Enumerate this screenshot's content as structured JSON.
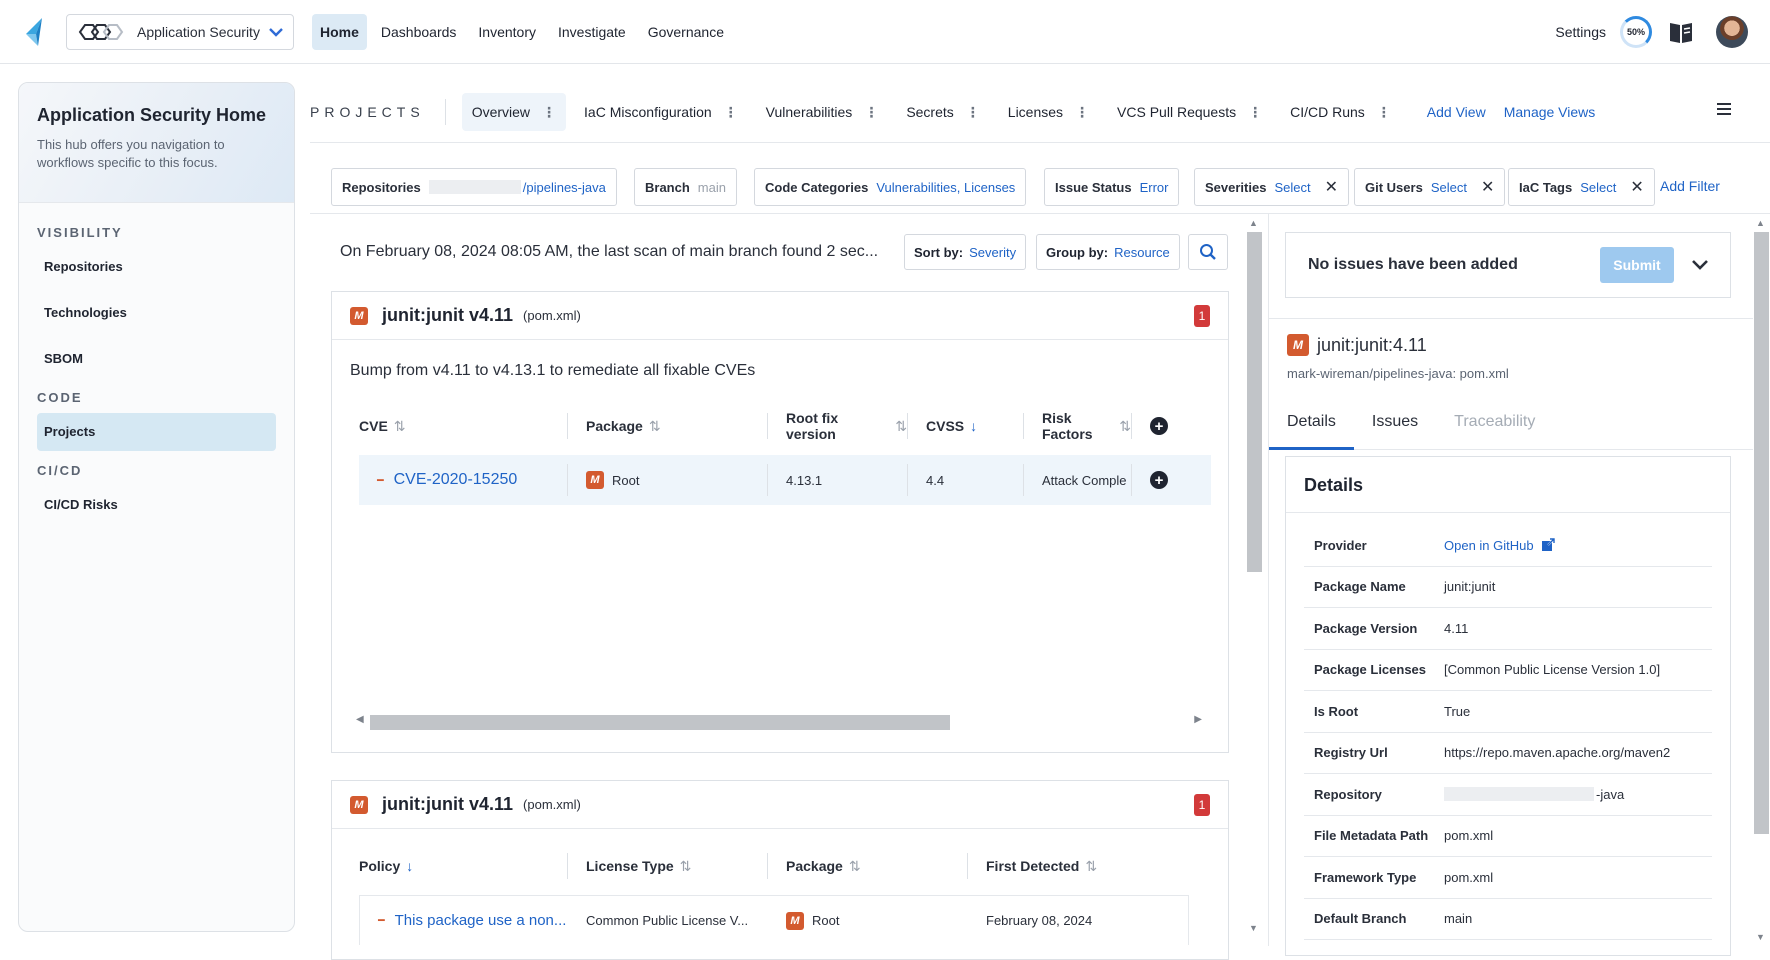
{
  "topnav": {
    "app_switcher": "Application Security",
    "items": [
      "Home",
      "Dashboards",
      "Inventory",
      "Investigate",
      "Governance"
    ],
    "settings": "Settings",
    "progress": "50%"
  },
  "hub": {
    "title": "Application Security Home",
    "description": "This hub offers you navigation to workflows specific to this focus.",
    "sections": [
      {
        "label": "VISIBILITY",
        "links": [
          "Repositories",
          "Technologies",
          "SBOM"
        ]
      },
      {
        "label": "CODE",
        "links": [
          "Projects"
        ]
      },
      {
        "label": "CI/CD",
        "links": [
          "CI/CD Risks"
        ]
      }
    ]
  },
  "tabs": {
    "section_label": "PROJECTS",
    "items": [
      "Overview",
      "IaC Misconfiguration",
      "Vulnerabilities",
      "Secrets",
      "Licenses",
      "VCS Pull Requests",
      "CI/CD Runs"
    ],
    "add_view": "Add View",
    "manage_views": "Manage Views"
  },
  "filters": {
    "repositories": {
      "key": "Repositories",
      "value": "/pipelines-java"
    },
    "branch": {
      "key": "Branch",
      "value": "main"
    },
    "code_categories": {
      "key": "Code Categories",
      "value": "Vulnerabilities, Licenses"
    },
    "issue_status": {
      "key": "Issue Status",
      "value": "Error"
    },
    "severities": {
      "key": "Severities",
      "value": "Select"
    },
    "git_users": {
      "key": "Git Users",
      "value": "Select"
    },
    "iac_tags": {
      "key": "IaC Tags",
      "value": "Select"
    },
    "add_filter": "Add Filter"
  },
  "main": {
    "scan_text": "On February 08, 2024 08:05 AM, the last scan of main branch found 2 sec...",
    "sort_by": {
      "key": "Sort by:",
      "value": "Severity"
    },
    "group_by": {
      "key": "Group by:",
      "value": "Resource"
    },
    "card1": {
      "badge": "M",
      "title": "junit:junit v4.11",
      "file": "(pom.xml)",
      "count": "1",
      "remediation": "Bump from v4.11 to v4.13.1 to remediate all fixable CVEs",
      "columns": [
        "CVE",
        "Package",
        "Root fix version",
        "CVSS",
        "Risk Factors"
      ],
      "row": {
        "cve": "CVE-2020-15250",
        "package": "Root",
        "root_fix": "4.13.1",
        "cvss": "4.4",
        "risk": "Attack Comple"
      }
    },
    "card2": {
      "badge": "M",
      "title": "junit:junit v4.11",
      "file": "(pom.xml)",
      "count": "1",
      "columns": [
        "Policy",
        "License Type",
        "Package",
        "First Detected"
      ],
      "row": {
        "policy": "This package use a non...",
        "license": "Common Public License V...",
        "package": "Root",
        "detected": "February 08, 2024"
      }
    }
  },
  "right_panel": {
    "issues_msg": "No issues have been added",
    "submit": "Submit",
    "package_badge": "M",
    "package_title": "junit:junit:4.11",
    "package_path": "mark-wireman/pipelines-java: pom.xml",
    "tabs": [
      "Details",
      "Issues",
      "Traceability"
    ],
    "details_title": "Details",
    "details": [
      {
        "k": "Provider",
        "v": "Open in GitHub"
      },
      {
        "k": "Package Name",
        "v": "junit:junit"
      },
      {
        "k": "Package Version",
        "v": "4.11"
      },
      {
        "k": "Package Licenses",
        "v": "[Common Public License Version 1.0]"
      },
      {
        "k": "Is Root",
        "v": "True"
      },
      {
        "k": "Registry Url",
        "v": "https://repo.maven.apache.org/maven2"
      },
      {
        "k": "Repository",
        "v": "-java"
      },
      {
        "k": "File Metadata Path",
        "v": "pom.xml"
      },
      {
        "k": "Framework Type",
        "v": "pom.xml"
      },
      {
        "k": "Default Branch",
        "v": "main"
      }
    ]
  },
  "colors": {
    "accent": "#1f63c6",
    "nav_active": "#dceaf5",
    "maven_badge": "#d35a2f",
    "count_badge": "#d23a3a",
    "submit": "#9ec9ef"
  }
}
